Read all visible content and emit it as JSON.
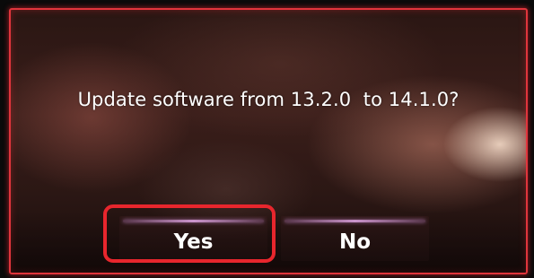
{
  "dialog": {
    "message": "Update software from 13.2.0  to 14.1.0?"
  },
  "buttons": {
    "yes_label": "Yes",
    "no_label": "No"
  },
  "colors": {
    "frame_accent": "#e0353c",
    "highlight_annotation": "#e8262d",
    "button_glow": "#e6aaeb",
    "text": "#ffffff"
  }
}
